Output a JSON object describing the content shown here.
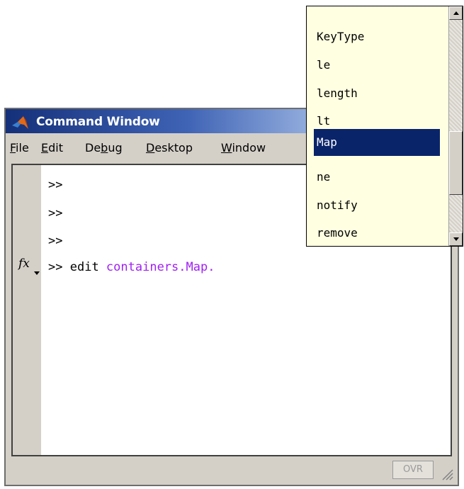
{
  "window": {
    "title": "Command Window",
    "icon": "matlab-logo-icon"
  },
  "menu": [
    {
      "label": "File",
      "mnemonic": "F"
    },
    {
      "label": "Edit",
      "mnemonic": "E"
    },
    {
      "label": "Debug",
      "mnemonic": "b"
    },
    {
      "label": "Desktop",
      "mnemonic": "D"
    },
    {
      "label": "Window",
      "mnemonic": "W"
    }
  ],
  "command_lines": [
    {
      "prompt": ">>",
      "command": "",
      "argument": ""
    },
    {
      "prompt": ">>",
      "command": "",
      "argument": ""
    },
    {
      "prompt": ">>",
      "command": "",
      "argument": ""
    },
    {
      "prompt": ">>",
      "command": "edit ",
      "argument": "containers.Map."
    }
  ],
  "gutter": {
    "function_browser_icon": "fx-icon",
    "label": "fx"
  },
  "status": {
    "ovr_label": "OVR"
  },
  "autocomplete": {
    "items": [
      "KeyType",
      "le",
      "length",
      "lt",
      "Map",
      "ne",
      "notify",
      "remove"
    ],
    "selected_index": 4
  },
  "colors": {
    "argument_text": "#a020f0",
    "selection_bg": "#0a246a",
    "popup_bg": "#ffffe1",
    "titlebar_start": "#15307a"
  }
}
